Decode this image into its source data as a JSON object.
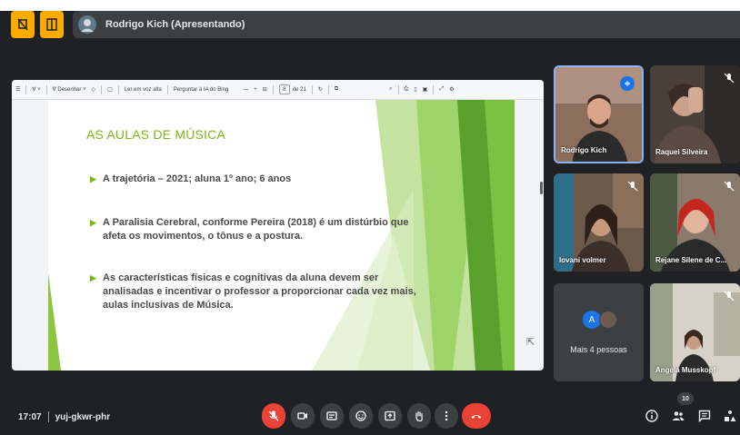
{
  "presenter": {
    "label": "Rodrigo Kich (Apresentando)"
  },
  "pdf_toolbar": {
    "draw_label": "Desenhar",
    "read_aloud_label": "Ler em voz alta",
    "ask_ai_label": "Perguntar à IA do Bing",
    "page_current": "8",
    "page_total": "de 21"
  },
  "slide": {
    "title": "AS AULAS DE MÚSICA",
    "bullets": [
      "A trajetória – 2021; aluna 1º ano; 6 anos",
      "A Paralisia Cerebral, conforme Pereira (2018) é um distúrbio que afeta os movimentos, o tônus e a postura.",
      "As características físicas e cognitivas da aluna devem ser analisadas e incentivar o professor a proporcionar cada vez mais, aulas inclusivas de Música."
    ]
  },
  "participants": [
    {
      "name": "Rodrigo Kich",
      "state": "speaking"
    },
    {
      "name": "Raquel Silveira",
      "state": "muted"
    },
    {
      "name": "Iovani volmer",
      "state": "muted"
    },
    {
      "name": "Rejane Silene de C...",
      "state": "muted"
    },
    {
      "name": "Angela Musskopf",
      "state": "muted"
    }
  ],
  "more_people": {
    "avatar_letter": "A",
    "label": "Mais 4 pessoas"
  },
  "bottom_bar": {
    "time": "17:07",
    "meeting_code": "yuj-gkwr-phr",
    "participant_count": "10"
  },
  "colors": {
    "meet_background": "#202124",
    "accent_yellow": "#f9ab00",
    "hangup_red": "#ea4335",
    "speaking_blue": "#1a73e8",
    "slide_green": "#7cb518"
  },
  "icons": {
    "top_left": [
      "pin-off-icon",
      "layout-icon"
    ],
    "controls": [
      "mic-off-icon",
      "camera-icon",
      "captions-icon",
      "emoji-icon",
      "present-icon",
      "raise-hand-icon",
      "more-options-icon",
      "hangup-icon"
    ],
    "right_controls": [
      "info-icon",
      "people-icon",
      "chat-icon",
      "activities-icon"
    ]
  }
}
